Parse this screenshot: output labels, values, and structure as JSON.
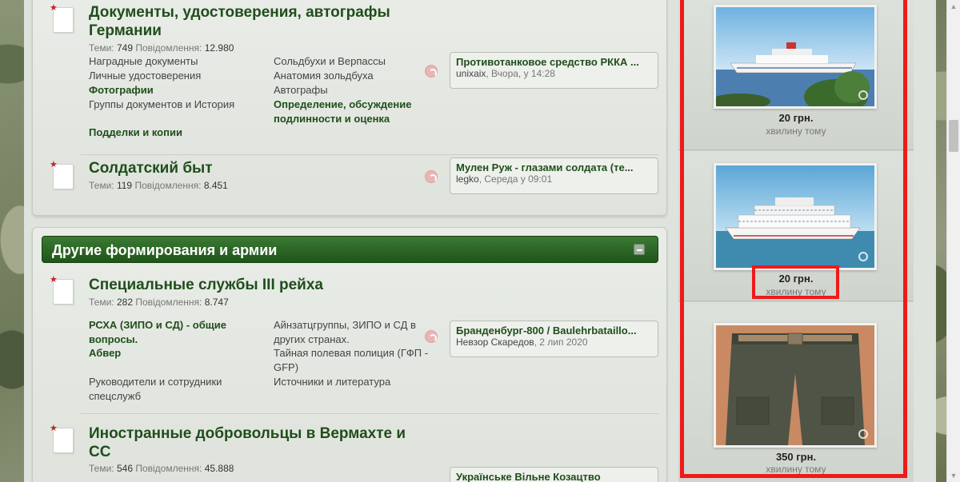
{
  "category": {
    "title": "Другие формирования и армии"
  },
  "stats_labels": {
    "topics": "Теми:",
    "posts": "Повідомлення:"
  },
  "nodes": {
    "docs": {
      "title": "Документы, удостоверения, автографы Германии",
      "topics": "749",
      "posts": "12.980",
      "subs": [
        "Наградные документы",
        "Личные удостоверения",
        "Фотографии",
        "Группы документов и История",
        "Подделки и копии",
        "Сольдбухи и Верпассы",
        "Анатомия зольдбуха",
        "Автографы",
        "Определение, обсуждение подлинности и оценка"
      ],
      "last_post": {
        "title": "Противотанковое средство РККА ...",
        "user": "unixaix",
        "date": "Вчора, у 14:28"
      }
    },
    "soldier": {
      "title": "Солдатский быт",
      "topics": "119",
      "posts": "8.451",
      "last_post": {
        "title": "Мулен Руж - глазами солдата (те...",
        "user": "legko",
        "date": "Середа у 09:01"
      }
    },
    "special": {
      "title": "Специальные службы III рейха",
      "topics": "282",
      "posts": "8.747",
      "subs": [
        "РСХА (ЗИПО и СД) - общие вопросы.",
        "Абвер",
        "Руководители и сотрудники спецслужб",
        "Айнзатцгруппы, ЗИПО и СД в других странах.",
        "Тайная полевая полиция (ГФП - GFP)",
        "Источники и литература"
      ],
      "last_post": {
        "title": "Бранденбург-800 / Baulehrbataillo...",
        "user": "Невзор Скаредов",
        "date": "2 лип 2020"
      }
    },
    "foreign": {
      "title": "Иностранные добровольцы в Вермахте и СС",
      "topics": "546",
      "posts": "45.888",
      "last_post": {
        "title": "Українське Вільне Козацтво"
      }
    }
  },
  "sidebar": {
    "ads": [
      {
        "price": "20 грн.",
        "time": "хвилину тому"
      },
      {
        "price": "20 грн.",
        "time": "хвилину тому"
      },
      {
        "price": "350 грн.",
        "time": "хвилину тому"
      }
    ]
  }
}
